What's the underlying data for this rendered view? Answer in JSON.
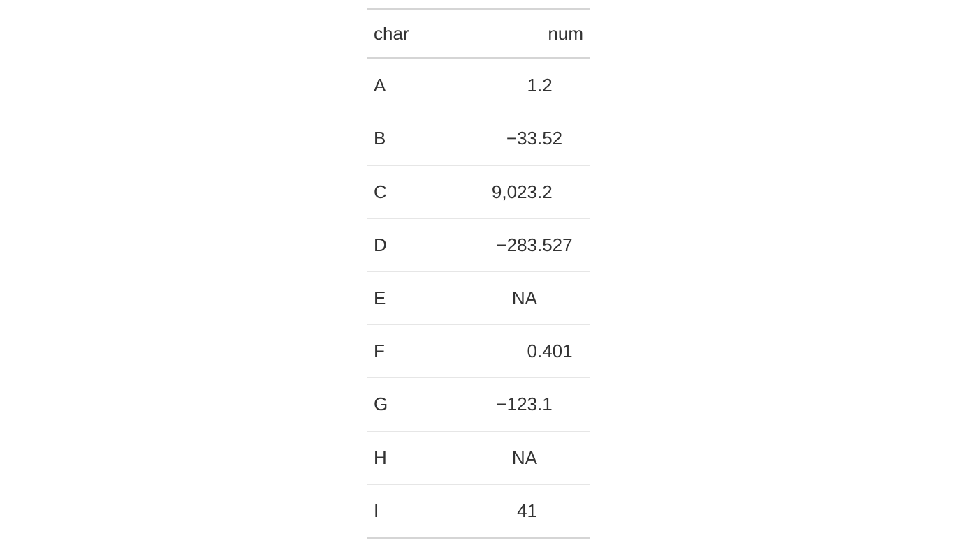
{
  "chart_data": {
    "type": "table",
    "columns": [
      "char",
      "num"
    ],
    "rows": [
      {
        "char": "A",
        "num": 1.2
      },
      {
        "char": "B",
        "num": -33.52
      },
      {
        "char": "C",
        "num": 9023.2
      },
      {
        "char": "D",
        "num": -283.527
      },
      {
        "char": "E",
        "num": null
      },
      {
        "char": "F",
        "num": 0.401
      },
      {
        "char": "G",
        "num": -123.1
      },
      {
        "char": "H",
        "num": null
      },
      {
        "char": "I",
        "num": 41
      }
    ],
    "na_label": "NA",
    "minus_sign": "−",
    "thousands_sep": ","
  },
  "table": {
    "headers": {
      "char": "char",
      "num": "num"
    },
    "rows": [
      {
        "char": "A",
        "int": "1",
        "dec": ".2"
      },
      {
        "char": "B",
        "int": "−33",
        "dec": ".52"
      },
      {
        "char": "C",
        "int": "9,023",
        "dec": ".2"
      },
      {
        "char": "D",
        "int": "−283",
        "dec": ".527"
      },
      {
        "char": "E",
        "int": "NA",
        "dec": ""
      },
      {
        "char": "F",
        "int": "0",
        "dec": ".401"
      },
      {
        "char": "G",
        "int": "−123",
        "dec": ".1"
      },
      {
        "char": "H",
        "int": "NA",
        "dec": ""
      },
      {
        "char": "I",
        "int": "41",
        "dec": ""
      }
    ]
  }
}
